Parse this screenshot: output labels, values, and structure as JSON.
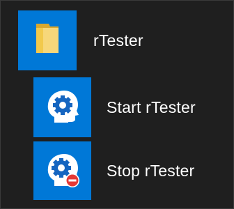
{
  "menu": {
    "folder": {
      "label": "rTester",
      "icon": "folder-icon",
      "tile_color": "#0078d7"
    },
    "items": [
      {
        "label": "Start rTester",
        "icon": "brain-gear-icon"
      },
      {
        "label": "Stop rTester",
        "icon": "brain-gear-stop-icon"
      }
    ]
  }
}
